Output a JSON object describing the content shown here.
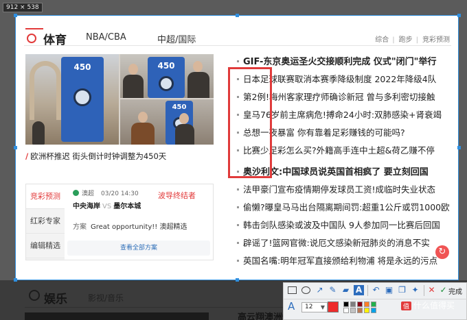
{
  "capture": {
    "size_label": "912 × 538"
  },
  "sports": {
    "title": "体育",
    "tabs": [
      "NBA/CBA",
      "中超/国际"
    ],
    "links": [
      "综合",
      "跑步",
      "竞彩预测"
    ],
    "photo_kiosk_numbers": [
      "450",
      "450",
      "450"
    ],
    "caption": "欧洲杯推迟 街头倒计时钟调整为450天",
    "lottery": {
      "nav": [
        "竞彩预测",
        "红彩专家",
        "编辑精选"
      ],
      "league": "澳超",
      "time": "03/20 14:30",
      "home": "中央海岸",
      "vs": "VS",
      "away": "墨尔本城",
      "prize_text": "波导终结者",
      "plan_label": "方案",
      "plan_text": "Great opportunity!! 澳超精选",
      "all_link": "查看全部方案"
    },
    "news": [
      "GIF-东京奥运圣火交接顺利完成 仪式\"闭门\"举行",
      "日本足球联赛取消本赛季降级制度 2022年降级4队",
      "第2例!梅州客家理疗师确诊新冠 曾与多利密切接触",
      "皇马76岁前主席病危!搏命24小时:双肺感染+肾衰竭",
      "总想一夜暴富 你有靠着足彩赚钱的可能吗?",
      "比赛少足彩怎么买?外籍高手连中土超&荷乙赚不停",
      "奥沙利文:中国球员说英国首相疯了 要立刻回国",
      "法甲豪门宣布疫情期停发球员工资!成临时失业状态",
      "偷懒?曝皇马马出台隔离期间罚:超重1公斤或罚1000欧",
      "韩击剑队感染或波及中国队 9人参加同一比赛后回国",
      "辟谣了!篮网官微:说厄文感染新冠肺炎的消息不实",
      "英国名嘴:明年冠军直接颁给利物浦 将是永远的污点"
    ]
  },
  "entertainment": {
    "title": "娱乐",
    "tab": "影视/音乐",
    "news_peek": "高云翔澳洲性侵案… 所有被告"
  },
  "toolbar": {
    "done_label": "完成",
    "font_size": "12",
    "current_color": "#ee2b2b",
    "swatches": [
      "#000000",
      "#7f7f7f",
      "#880015",
      "#ff7f27",
      "#22b14c",
      "#ffffff",
      "#c3c3c3",
      "#b97a57",
      "#fff200",
      "#00a2e8"
    ]
  },
  "watermark": {
    "badge": "值",
    "text": "什么值得买"
  },
  "colors": {
    "accent": "#e23a3a",
    "selection": "#2f8fe0",
    "annotation": "#e03a3a"
  }
}
